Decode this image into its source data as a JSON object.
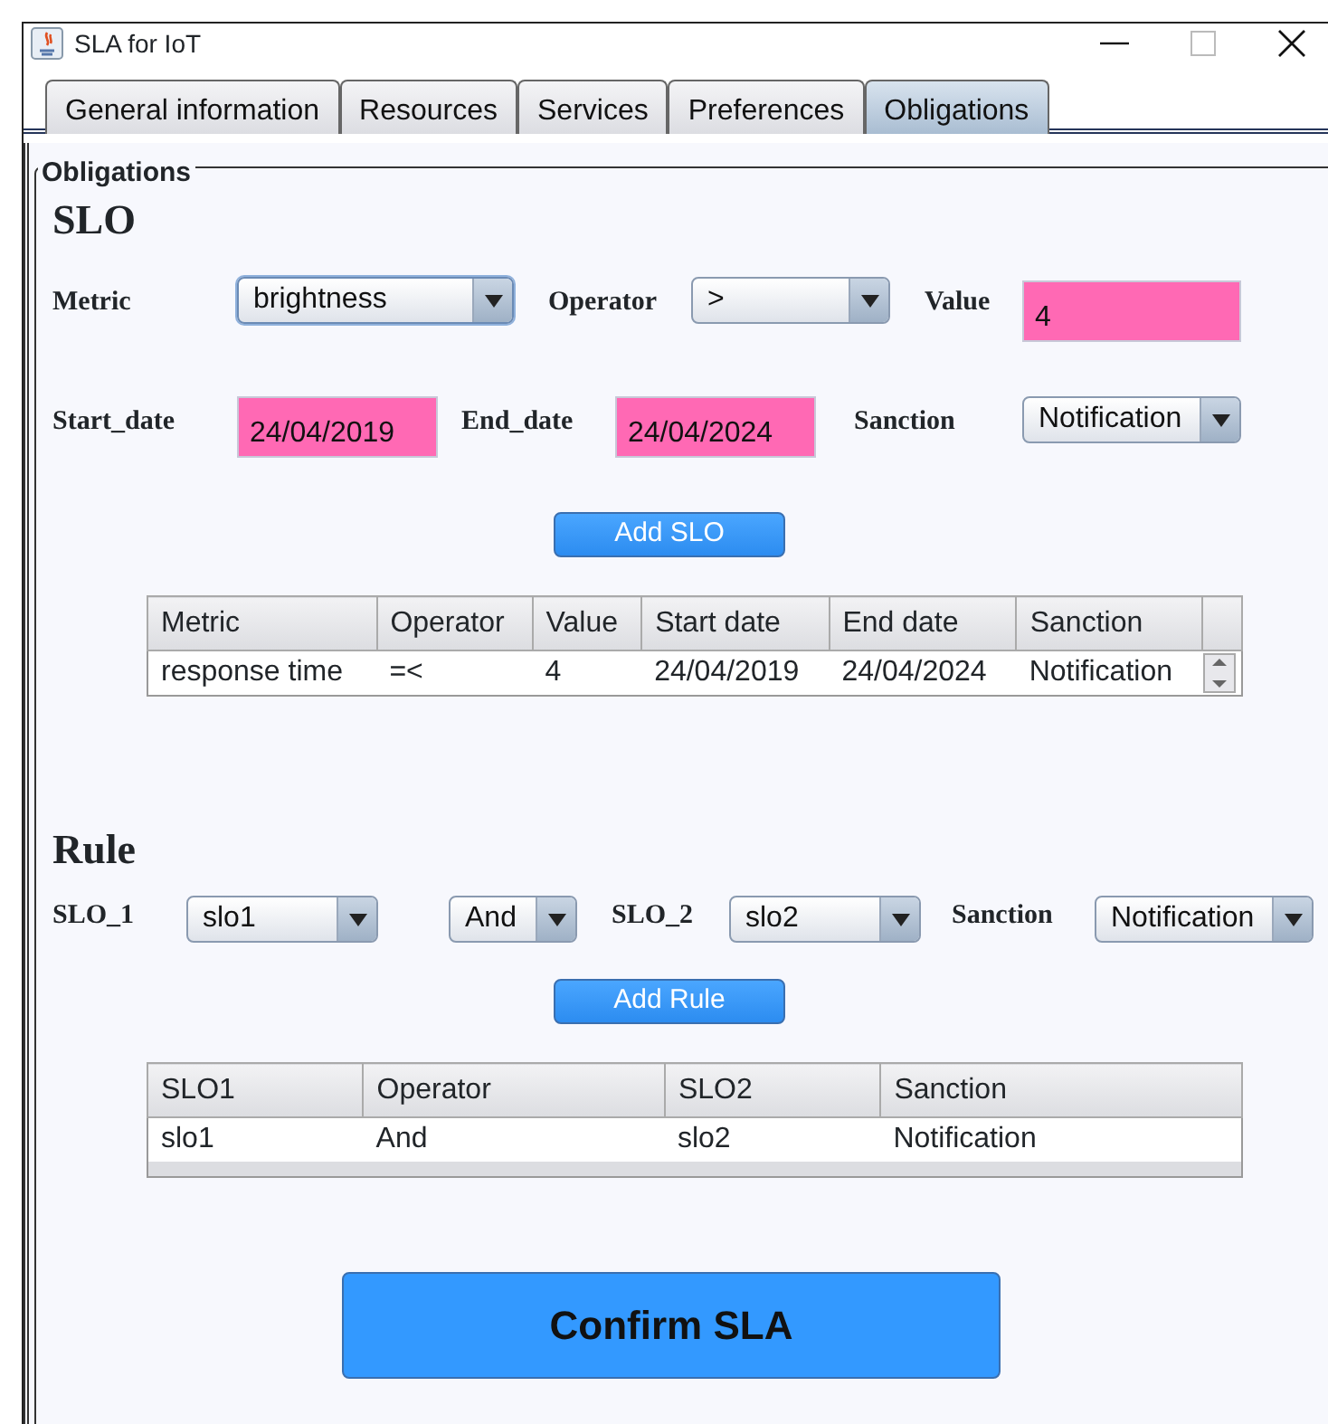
{
  "window": {
    "title": "SLA for IoT"
  },
  "tabs": [
    {
      "label": "General information",
      "selected": false
    },
    {
      "label": "Resources",
      "selected": false
    },
    {
      "label": "Services",
      "selected": false
    },
    {
      "label": "Preferences",
      "selected": false
    },
    {
      "label": "Obligations",
      "selected": true
    }
  ],
  "panel": {
    "title": "Obligations"
  },
  "slo": {
    "heading": "SLO",
    "rows": [
      [
        {
          "kind": "label",
          "text": "Metric"
        },
        {
          "kind": "combo",
          "value": "brightness",
          "focused": true
        },
        {
          "kind": "label",
          "text": "Operator"
        },
        {
          "kind": "combo",
          "value": ">",
          "focused": false
        },
        {
          "kind": "label",
          "text": "Value"
        },
        {
          "kind": "text",
          "value": "4"
        }
      ],
      [
        {
          "kind": "label",
          "text": "Start_date"
        },
        {
          "kind": "text",
          "value": "24/04/2019"
        },
        {
          "kind": "label",
          "text": "End_date"
        },
        {
          "kind": "text",
          "value": "24/04/2024"
        },
        {
          "kind": "label",
          "text": "Sanction"
        },
        {
          "kind": "combo",
          "value": "Notification",
          "focused": false
        }
      ]
    ],
    "button": "Add SLO",
    "table": {
      "columns": [
        "Metric",
        "Operator",
        "Value",
        "Start date",
        "End date",
        "Sanction"
      ],
      "rows": [
        [
          "response time",
          "=<",
          "4",
          "24/04/2019",
          "24/04/2024",
          "Notification"
        ]
      ]
    }
  },
  "rule": {
    "heading": "Rule",
    "rows": [
      [
        {
          "kind": "label",
          "text": "SLO_1"
        },
        {
          "kind": "combo",
          "value": "slo1",
          "focused": false
        },
        {
          "kind": "combo",
          "value": "And",
          "focused": false
        },
        {
          "kind": "label",
          "text": "SLO_2"
        },
        {
          "kind": "combo",
          "value": "slo2",
          "focused": false
        },
        {
          "kind": "label",
          "text": "Sanction"
        },
        {
          "kind": "combo",
          "value": "Notification",
          "focused": false
        }
      ]
    ],
    "button": "Add Rule",
    "table": {
      "columns": [
        "SLO1",
        "Operator",
        "SLO2",
        "Sanction"
      ],
      "rows": [
        [
          "slo1",
          "And",
          "slo2",
          "Notification"
        ]
      ]
    }
  },
  "confirm_button": "Confirm SLA"
}
